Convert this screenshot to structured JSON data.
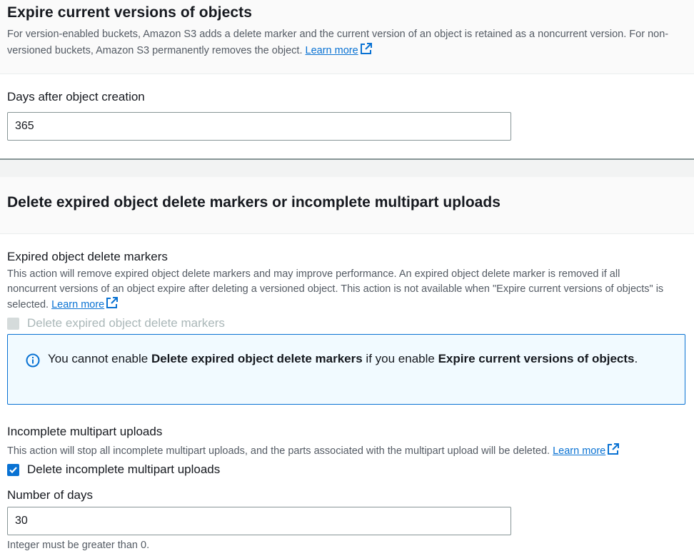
{
  "expire_section": {
    "title": "Expire current versions of objects",
    "description": "For version-enabled buckets, Amazon S3 adds a delete marker and the current version of an object is retained as a noncurrent version. For non-versioned buckets, Amazon S3 permanently removes the object.",
    "learn_more": "Learn more",
    "days_label": "Days after object creation",
    "days_value": "365"
  },
  "delete_section": {
    "title": "Delete expired object delete markers or incomplete multipart uploads",
    "markers": {
      "label": "Expired object delete markers",
      "description": "This action will remove expired object delete markers and may improve performance. An expired object delete marker is removed if all noncurrent versions of an object expire after deleting a versioned object. This action is not available when \"Expire current versions of objects\" is selected.",
      "learn_more": "Learn more",
      "checkbox_label": "Delete expired object delete markers",
      "checkbox_checked": false,
      "checkbox_disabled": true
    },
    "alert": {
      "text_1": "You cannot enable ",
      "bold_1": "Delete expired object delete markers",
      "text_2": " if you enable ",
      "bold_2": "Expire current versions of objects",
      "text_3": "."
    },
    "multipart": {
      "label": "Incomplete multipart uploads",
      "description": "This action will stop all incomplete multipart uploads, and the parts associated with the multipart upload will be deleted.",
      "learn_more": "Learn more",
      "checkbox_label": "Delete incomplete multipart uploads",
      "checkbox_checked": true,
      "days_label": "Number of days",
      "days_value": "30",
      "days_hint": "Integer must be greater than 0."
    }
  },
  "colors": {
    "link": "#0972d3",
    "checkbox_checked": "#0972d3",
    "alert_bg": "#f1faff",
    "alert_border": "#0972d3"
  },
  "icons": {
    "external_link": "external-link-icon",
    "info": "info-icon",
    "check": "check-icon"
  }
}
